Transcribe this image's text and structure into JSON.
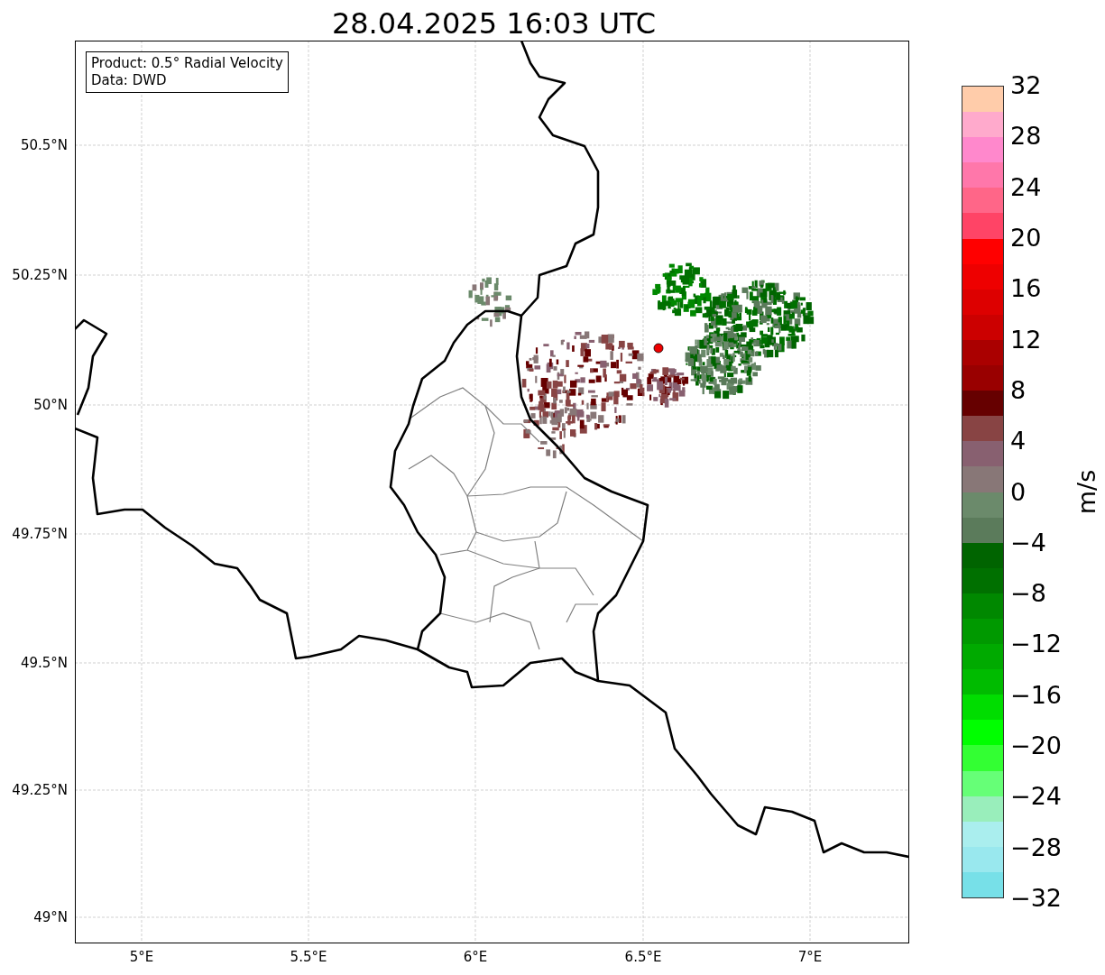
{
  "title": "28.04.2025 16:03 UTC",
  "info_box": [
    "Product: 0.5° Radial Velocity",
    "Data: DWD"
  ],
  "map": {
    "x_ticks": [
      "5°E",
      "5.5°E",
      "6°E",
      "6.5°E",
      "7°E"
    ],
    "y_ticks": [
      "50.5°N",
      "50.25°N",
      "50°N",
      "49.75°N",
      "49.5°N",
      "49.25°N",
      "49°N"
    ]
  },
  "colorbar": {
    "label": "m/s",
    "ticks": [
      "32",
      "28",
      "24",
      "20",
      "16",
      "12",
      "8",
      "4",
      "0",
      "−4",
      "−8",
      "−12",
      "−16",
      "−20",
      "−24",
      "−28",
      "−32"
    ],
    "bins": [
      {
        "color": "#ffccaa"
      },
      {
        "color": "#ffaacc"
      },
      {
        "color": "#ff88cc"
      },
      {
        "color": "#ff77aa"
      },
      {
        "color": "#ff6688"
      },
      {
        "color": "#ff4466"
      },
      {
        "color": "#ff0000"
      },
      {
        "color": "#ee0000"
      },
      {
        "color": "#dd0000"
      },
      {
        "color": "#cc0000"
      },
      {
        "color": "#aa0000"
      },
      {
        "color": "#990000"
      },
      {
        "color": "#660000"
      },
      {
        "color": "#884444"
      },
      {
        "color": "#886070"
      },
      {
        "color": "#887777"
      },
      {
        "color": "#6b8a6b"
      },
      {
        "color": "#5b7b5b"
      },
      {
        "color": "#006400"
      },
      {
        "color": "#007000"
      },
      {
        "color": "#008800"
      },
      {
        "color": "#009900"
      },
      {
        "color": "#00aa00"
      },
      {
        "color": "#00bb00"
      },
      {
        "color": "#00dd00"
      },
      {
        "color": "#00ff00"
      },
      {
        "color": "#33ff33"
      },
      {
        "color": "#66ff77"
      },
      {
        "color": "#99eebb"
      },
      {
        "color": "#aaeeee"
      },
      {
        "color": "#99e8ee"
      },
      {
        "color": "#77e0e8"
      }
    ]
  }
}
